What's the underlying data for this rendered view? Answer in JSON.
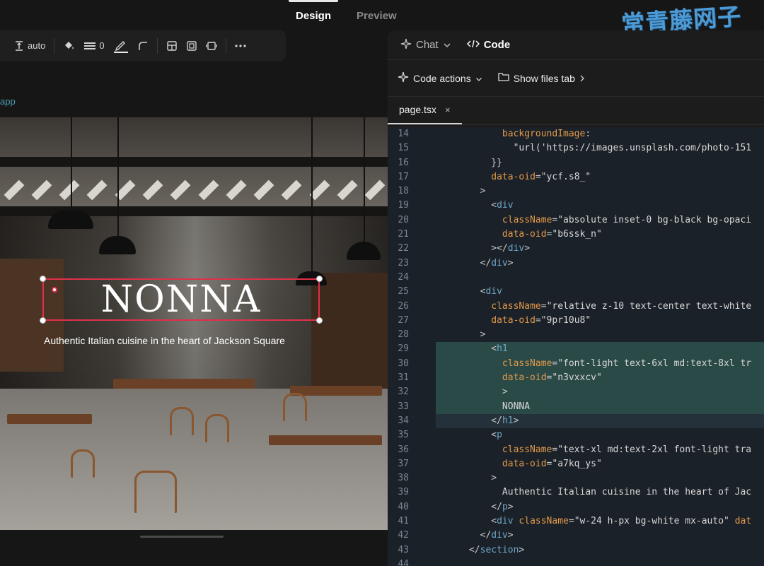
{
  "mode_tabs": [
    {
      "label": "Design",
      "active": true
    },
    {
      "label": "Preview",
      "active": false
    }
  ],
  "watermark": "常青藤网子",
  "toolbar": {
    "height_label": "auto",
    "border_width": "0",
    "icons": [
      "vertical-size-icon",
      "paint-bucket-icon",
      "border-lines-icon",
      "pen-stroke-icon",
      "corner-radius-icon",
      "layout-grid-icon",
      "frame-icon",
      "padding-icon",
      "more-icon"
    ]
  },
  "app_label": "app",
  "preview": {
    "title": "NONNA",
    "subtitle": "Authentic Italian cuisine in the heart of Jackson Square"
  },
  "panel": {
    "tabs": [
      {
        "label": "Chat",
        "icon": "sparkle-icon"
      },
      {
        "label": "Code",
        "icon": "code-brackets-icon"
      }
    ],
    "actions": [
      {
        "label": "Code actions",
        "icon": "sparkle-icon"
      },
      {
        "label": "Show files tab",
        "icon": "folder-icon"
      }
    ],
    "file_tab": "page.tsx",
    "close_glyph": "×"
  },
  "code_lines": [
    {
      "n": "14",
      "indent": 12,
      "parts": [
        [
          "attr",
          "backgroundImage"
        ],
        [
          "punc",
          ":"
        ]
      ]
    },
    {
      "n": "15",
      "indent": 14,
      "parts": [
        [
          "str",
          "\"url('https://images.unsplash.com/photo-151"
        ]
      ]
    },
    {
      "n": "16",
      "indent": 10,
      "parts": [
        [
          "punc",
          "}}"
        ]
      ]
    },
    {
      "n": "17",
      "indent": 10,
      "parts": [
        [
          "attr",
          "data-oid"
        ],
        [
          "punc",
          "="
        ],
        [
          "str",
          "\"ycf.s8_\""
        ]
      ]
    },
    {
      "n": "18",
      "indent": 8,
      "parts": [
        [
          "punc",
          ">"
        ]
      ]
    },
    {
      "n": "19",
      "indent": 10,
      "parts": [
        [
          "punc",
          "<"
        ],
        [
          "tag",
          "div"
        ]
      ]
    },
    {
      "n": "20",
      "indent": 12,
      "parts": [
        [
          "attr",
          "className"
        ],
        [
          "punc",
          "="
        ],
        [
          "str",
          "\"absolute inset-0 bg-black bg-opaci"
        ]
      ]
    },
    {
      "n": "21",
      "indent": 12,
      "parts": [
        [
          "attr",
          "data-oid"
        ],
        [
          "punc",
          "="
        ],
        [
          "str",
          "\"b6ssk_n\""
        ]
      ]
    },
    {
      "n": "22",
      "indent": 10,
      "parts": [
        [
          "punc",
          "></"
        ],
        [
          "tag",
          "div"
        ],
        [
          "punc",
          ">"
        ]
      ]
    },
    {
      "n": "23",
      "indent": 8,
      "parts": [
        [
          "punc",
          "</"
        ],
        [
          "tag",
          "div"
        ],
        [
          "punc",
          ">"
        ]
      ]
    },
    {
      "n": "24",
      "indent": 0,
      "parts": []
    },
    {
      "n": "25",
      "indent": 8,
      "parts": [
        [
          "punc",
          "<"
        ],
        [
          "tag",
          "div"
        ]
      ]
    },
    {
      "n": "26",
      "indent": 10,
      "parts": [
        [
          "attr",
          "className"
        ],
        [
          "punc",
          "="
        ],
        [
          "str",
          "\"relative z-10 text-center text-white"
        ]
      ]
    },
    {
      "n": "27",
      "indent": 10,
      "parts": [
        [
          "attr",
          "data-oid"
        ],
        [
          "punc",
          "="
        ],
        [
          "str",
          "\"9pr10u8\""
        ]
      ]
    },
    {
      "n": "28",
      "indent": 8,
      "parts": [
        [
          "punc",
          ">"
        ]
      ]
    },
    {
      "n": "29",
      "indent": 10,
      "hl": "start",
      "parts": [
        [
          "punc",
          "<"
        ],
        [
          "tag",
          "h1"
        ]
      ]
    },
    {
      "n": "30",
      "indent": 12,
      "hl": "full",
      "parts": [
        [
          "attr",
          "className"
        ],
        [
          "punc",
          "="
        ],
        [
          "str",
          "\"font-light text-6xl md:text-8xl tr"
        ]
      ]
    },
    {
      "n": "31",
      "indent": 12,
      "hl": "full",
      "parts": [
        [
          "attr",
          "data-oid"
        ],
        [
          "punc",
          "="
        ],
        [
          "str",
          "\"n3vxxcv\""
        ]
      ]
    },
    {
      "n": "32",
      "indent": 12,
      "hl": "full",
      "parts": [
        [
          "punc",
          ">"
        ]
      ]
    },
    {
      "n": "33",
      "indent": 12,
      "hl": "full",
      "parts": [
        [
          "str",
          "NONNA"
        ]
      ]
    },
    {
      "n": "34",
      "indent": 10,
      "hl": "end",
      "parts": [
        [
          "punc",
          "</"
        ],
        [
          "tag",
          "h1"
        ],
        [
          "punc",
          ">"
        ]
      ]
    },
    {
      "n": "35",
      "indent": 10,
      "parts": [
        [
          "punc",
          "<"
        ],
        [
          "tag",
          "p"
        ]
      ]
    },
    {
      "n": "36",
      "indent": 12,
      "parts": [
        [
          "attr",
          "className"
        ],
        [
          "punc",
          "="
        ],
        [
          "str",
          "\"text-xl md:text-2xl font-light tra"
        ]
      ]
    },
    {
      "n": "37",
      "indent": 12,
      "parts": [
        [
          "attr",
          "data-oid"
        ],
        [
          "punc",
          "="
        ],
        [
          "str",
          "\"a7kq_ys\""
        ]
      ]
    },
    {
      "n": "38",
      "indent": 10,
      "parts": [
        [
          "punc",
          ">"
        ]
      ]
    },
    {
      "n": "39",
      "indent": 12,
      "parts": [
        [
          "str",
          "Authentic Italian cuisine in the heart of Jac"
        ]
      ]
    },
    {
      "n": "40",
      "indent": 10,
      "parts": [
        [
          "punc",
          "</"
        ],
        [
          "tag",
          "p"
        ],
        [
          "punc",
          ">"
        ]
      ]
    },
    {
      "n": "41",
      "indent": 10,
      "parts": [
        [
          "punc",
          "<"
        ],
        [
          "tag",
          "div"
        ],
        [
          "punc",
          " "
        ],
        [
          "attr",
          "className"
        ],
        [
          "punc",
          "="
        ],
        [
          "str",
          "\"w-24 h-px bg-white mx-auto\""
        ],
        [
          "punc",
          " "
        ],
        [
          "attr",
          "dat"
        ]
      ]
    },
    {
      "n": "42",
      "indent": 8,
      "parts": [
        [
          "punc",
          "</"
        ],
        [
          "tag",
          "div"
        ],
        [
          "punc",
          ">"
        ]
      ]
    },
    {
      "n": "43",
      "indent": 6,
      "parts": [
        [
          "punc",
          "</"
        ],
        [
          "tag",
          "section"
        ],
        [
          "punc",
          ">"
        ]
      ]
    },
    {
      "n": "44",
      "indent": 0,
      "parts": []
    }
  ]
}
